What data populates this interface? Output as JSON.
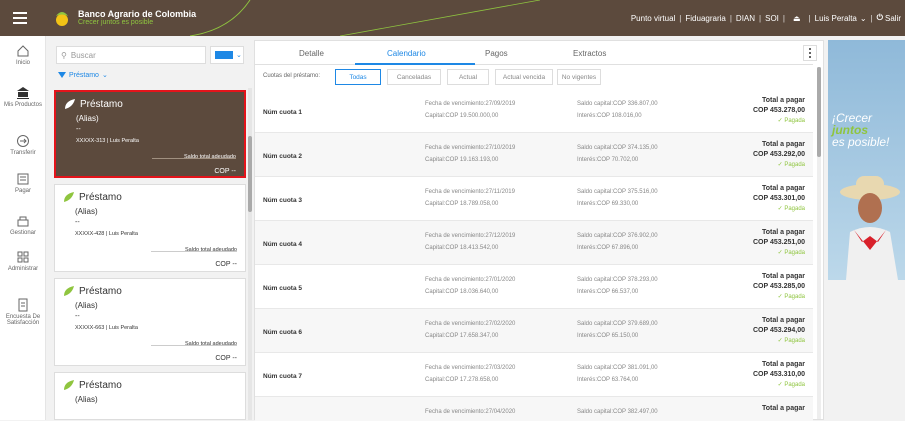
{
  "header": {
    "brand_name": "Banco Agrario de Colombia",
    "brand_tagline": "Crecer juntos es posible",
    "links": [
      "Punto virtual",
      "Fiduagraria",
      "DIAN",
      "SOI"
    ],
    "user": "Luis Peralta",
    "logout": "Salir"
  },
  "nav": [
    {
      "label": "Inicio",
      "icon": "home-icon"
    },
    {
      "label": "Mis Productos",
      "icon": "bank-icon"
    },
    {
      "label": "Transferir",
      "icon": "transfer-icon"
    },
    {
      "label": "Pagar",
      "icon": "pay-icon"
    },
    {
      "label": "Gestionar",
      "icon": "manage-icon"
    },
    {
      "label": "Administrar",
      "icon": "admin-icon"
    },
    {
      "label": "Encuesta De Satisfacción",
      "icon": "survey-icon"
    }
  ],
  "list": {
    "search_placeholder": "Buscar",
    "filter_label": "Préstamo",
    "cards": [
      {
        "title": "Préstamo",
        "alias": "(Alias)",
        "dash": "--",
        "account": "XXXXX-313 | Luis Peralta",
        "saldo_label": "Saldo total adeudado",
        "amount": "COP --"
      },
      {
        "title": "Préstamo",
        "alias": "(Alias)",
        "dash": "--",
        "account": "XXXXX-428 | Luis Peralta",
        "saldo_label": "Saldo total adeudado",
        "amount": "COP --"
      },
      {
        "title": "Préstamo",
        "alias": "(Alias)",
        "dash": "--",
        "account": "XXXXX-663 | Luis Peralta",
        "saldo_label": "Saldo total adeudado",
        "amount": "COP --"
      },
      {
        "title": "Préstamo",
        "alias": "(Alias)"
      }
    ]
  },
  "main": {
    "tabs": [
      "Detalle",
      "Calendario",
      "Pagos",
      "Extractos"
    ],
    "active_tab": "Calendario",
    "filter_label": "Cuotas del préstamo:",
    "filters": [
      "Todas",
      "Canceladas",
      "Actual",
      "Actual vencida",
      "No vigentes"
    ],
    "active_filter": "Todas",
    "rows": [
      {
        "num": "Núm cuota 1",
        "fecha": "Fecha de vencimiento:27/09/2019",
        "capital": "Capital:COP 19.500.000,00",
        "saldo": "Saldo capital:COP 336.807,00",
        "interes": "Interés:COP 108.016,00",
        "total_label": "Total a pagar",
        "total": "COP 453.278,00",
        "status": "Pagada"
      },
      {
        "num": "Núm cuota 2",
        "fecha": "Fecha de vencimiento:27/10/2019",
        "capital": "Capital:COP 19.163.193,00",
        "saldo": "Saldo capital:COP 374.135,00",
        "interes": "Interés:COP 70.702,00",
        "total_label": "Total a pagar",
        "total": "COP 453.292,00",
        "status": "Pagada"
      },
      {
        "num": "Núm cuota 3",
        "fecha": "Fecha de vencimiento:27/11/2019",
        "capital": "Capital:COP 18.789.058,00",
        "saldo": "Saldo capital:COP 375.516,00",
        "interes": "Interés:COP 69.330,00",
        "total_label": "Total a pagar",
        "total": "COP 453.301,00",
        "status": "Pagada"
      },
      {
        "num": "Núm cuota 4",
        "fecha": "Fecha de vencimiento:27/12/2019",
        "capital": "Capital:COP 18.413.542,00",
        "saldo": "Saldo capital:COP 376.902,00",
        "interes": "Interés:COP 67.896,00",
        "total_label": "Total a pagar",
        "total": "COP 453.251,00",
        "status": "Pagada"
      },
      {
        "num": "Núm cuota 5",
        "fecha": "Fecha de vencimiento:27/01/2020",
        "capital": "Capital:COP 18.036.640,00",
        "saldo": "Saldo capital:COP 378.293,00",
        "interes": "Interés:COP 66.537,00",
        "total_label": "Total a pagar",
        "total": "COP 453.285,00",
        "status": "Pagada"
      },
      {
        "num": "Núm cuota 6",
        "fecha": "Fecha de vencimiento:27/02/2020",
        "capital": "Capital:COP 17.658.347,00",
        "saldo": "Saldo capital:COP 379.689,00",
        "interes": "Interés:COP 65.150,00",
        "total_label": "Total a pagar",
        "total": "COP 453.294,00",
        "status": "Pagada"
      },
      {
        "num": "Núm cuota 7",
        "fecha": "Fecha de vencimiento:27/03/2020",
        "capital": "Capital:COP 17.278.658,00",
        "saldo": "Saldo capital:COP 381.091,00",
        "interes": "Interés:COP 63.764,00",
        "total_label": "Total a pagar",
        "total": "COP 453.310,00",
        "status": "Pagada"
      },
      {
        "num": "",
        "fecha": "Fecha de vencimiento:27/04/2020",
        "capital": "",
        "saldo": "Saldo capital:COP 382.497,00",
        "interes": "",
        "total_label": "Total a pagar",
        "total": "",
        "status": ""
      }
    ]
  },
  "ad": {
    "line1": "¡Crecer",
    "line2": "juntos",
    "line3": "es posible!"
  },
  "colors": {
    "brand_brown": "#5c4a3d",
    "accent_blue": "#1e88e5",
    "green": "#8fc53f",
    "selected_border": "#e3141b"
  }
}
